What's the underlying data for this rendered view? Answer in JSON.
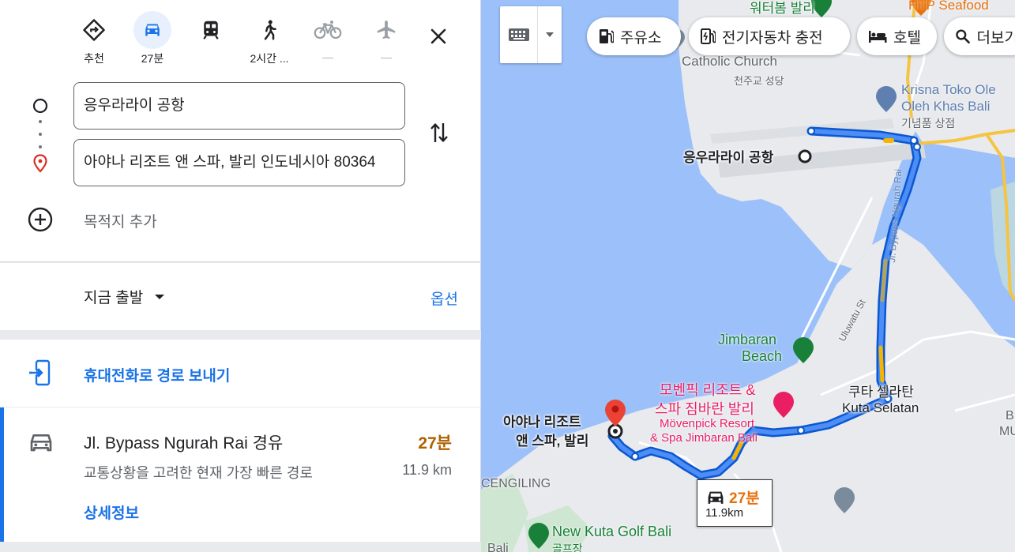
{
  "travel_modes": [
    {
      "id": "recommended",
      "icon": "directions-icon",
      "label": "추천",
      "selected": false
    },
    {
      "id": "car",
      "icon": "car-icon",
      "label": "27분",
      "selected": true
    },
    {
      "id": "transit",
      "icon": "train-icon",
      "label": "",
      "selected": false
    },
    {
      "id": "walk",
      "icon": "walk-icon",
      "label": "2시간 ...",
      "selected": false
    },
    {
      "id": "bike",
      "icon": "bike-icon",
      "label": "—",
      "selected": false
    },
    {
      "id": "flight",
      "icon": "plane-icon",
      "label": "—",
      "selected": false
    }
  ],
  "origin": {
    "value": "응우라라이 공항"
  },
  "destination": {
    "value": "아야나 리조트 앤 스파, 발리 인도네시아 80364"
  },
  "add_destination_label": "목적지 추가",
  "depart": {
    "label": "지금 출발",
    "options_label": "옵션"
  },
  "send_to_phone_label": "휴대전화로 경로 보내기",
  "route": {
    "title": "Jl. Bypass Ngurah Rai 경유",
    "duration": "27분",
    "description": "교통상황을 고려한 현재 가장 빠른 경로",
    "distance": "11.9 km",
    "details_label": "상세정보"
  },
  "map": {
    "chips": [
      {
        "icon": "gas-station-icon",
        "label": "주유소"
      },
      {
        "icon": "ev-charging-icon",
        "label": "전기자동차 충전"
      },
      {
        "icon": "hotel-icon",
        "label": "호텔"
      },
      {
        "icon": "search-icon",
        "label": "더보기"
      }
    ],
    "labels": {
      "waterbom": "워터봄 발리",
      "htp": "HTP Seafood",
      "catholic_en": "Catholic Church",
      "catholic_ko": "천주교 성당",
      "krisna_1": "Krisna Toko Ole",
      "krisna_2": "Oleh Khas Bali",
      "krisna_ko": "기념품 상점",
      "airport": "응우라라이 공항",
      "bypass": "Jl. Bypass Ngurah Rai",
      "uluwatu": "Uluwatu St",
      "jimbaran_1": "Jimbaran",
      "jimbaran_2": "Beach",
      "movenpick_ko_1": "모벤픽 리조트 &",
      "movenpick_ko_2": "스파 짐바란 발리",
      "movenpick_en_1": "Mövenpick Resort",
      "movenpick_en_2": "& Spa Jimbaran Bali",
      "kuta_ko": "쿠타 셀라탄",
      "kuta_en": "Kuta Selatan",
      "ayana_1": "아야나 리조트",
      "ayana_2": "앤 스파, 발리",
      "cengiling": "CENGILING",
      "golf_en": "New Kuta Golf Bali",
      "golf_ko": "골프장",
      "bali_bottom": "Bali",
      "edge_b": "B",
      "edge_mu": "MU"
    },
    "callout": {
      "duration": "27분",
      "distance": "11.9km"
    },
    "colors": {
      "water": "#9cc0f9",
      "land": "#e8eaed",
      "route": "#1a73e8",
      "traffic": "#f4b400"
    }
  }
}
